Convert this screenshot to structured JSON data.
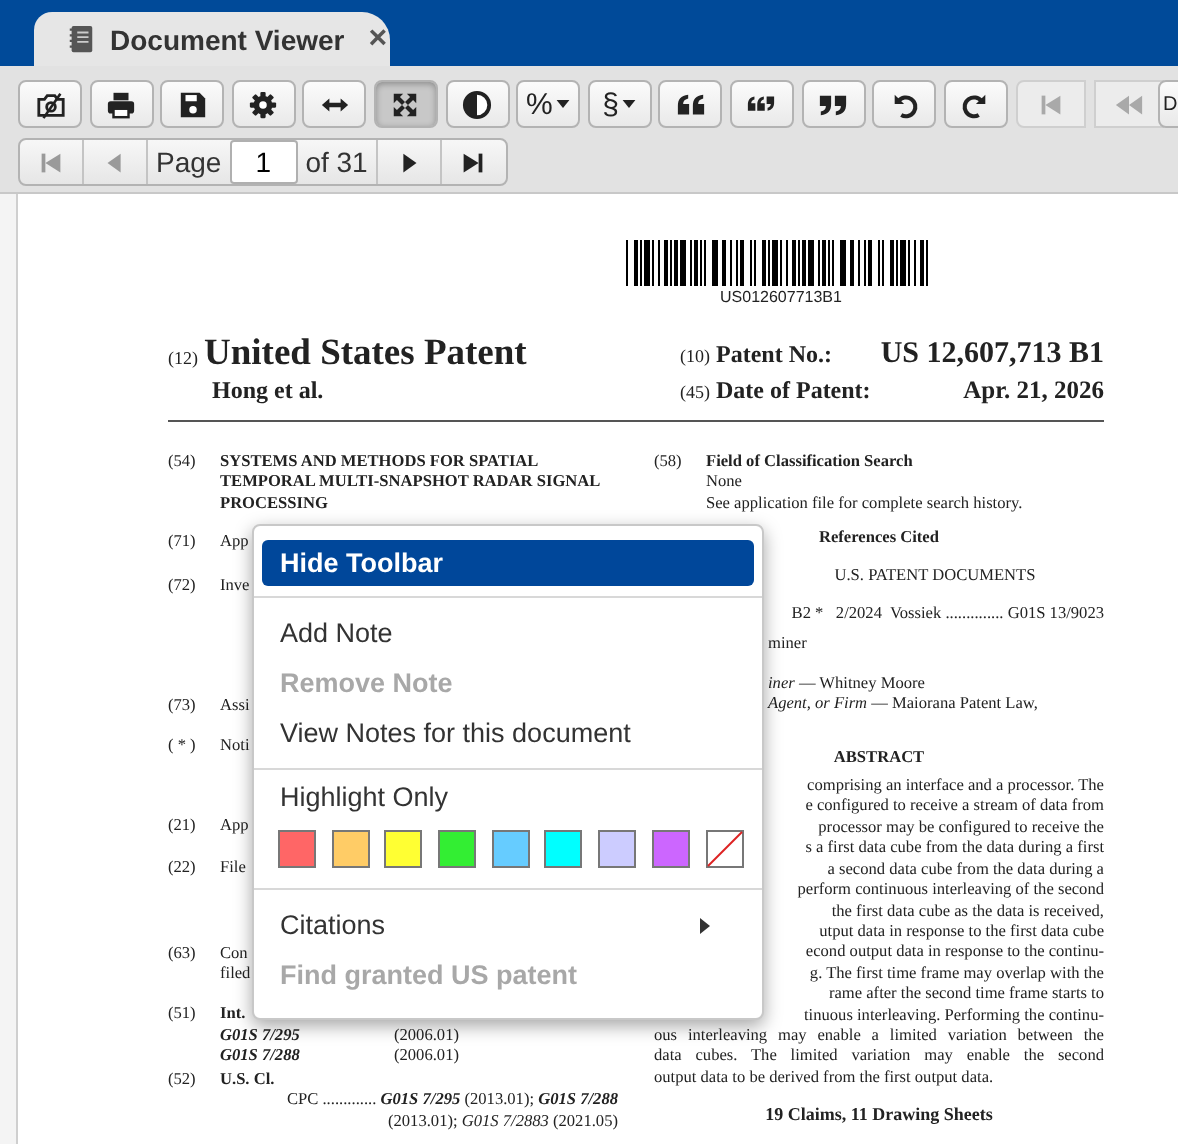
{
  "tab": {
    "title": "Document Viewer",
    "close": "×"
  },
  "toolbar": [
    {
      "pressed": false,
      "disabled": false,
      "dropdown": false
    },
    {
      "pressed": false,
      "disabled": false,
      "dropdown": false
    },
    {
      "pressed": false,
      "disabled": false,
      "dropdown": false
    },
    {
      "pressed": false,
      "disabled": false,
      "dropdown": false
    },
    {
      "pressed": false,
      "disabled": false,
      "dropdown": false
    },
    {
      "pressed": true,
      "disabled": false,
      "dropdown": false
    },
    {
      "pressed": false,
      "disabled": false,
      "dropdown": false
    },
    {
      "label": "%",
      "pressed": false,
      "disabled": false,
      "dropdown": true
    },
    {
      "label": "§",
      "pressed": false,
      "disabled": false,
      "dropdown": true
    },
    {
      "pressed": false,
      "disabled": false,
      "dropdown": false
    },
    {
      "pressed": false,
      "disabled": false,
      "dropdown": false
    },
    {
      "pressed": false,
      "disabled": false,
      "dropdown": false
    },
    {
      "pressed": false,
      "disabled": false,
      "dropdown": false
    },
    {
      "pressed": false,
      "disabled": false,
      "dropdown": false
    },
    {
      "pressed": false,
      "disabled": true,
      "dropdown": false
    },
    {
      "pressed": false,
      "disabled": true,
      "dropdown": false
    },
    {
      "label": "D",
      "pressed": false,
      "disabled": false
    }
  ],
  "pager": {
    "first": {
      "disabled": true
    },
    "previous": {
      "disabled": true
    },
    "label": "Page",
    "page": "1",
    "of": "of 31",
    "next": {
      "disabled": false
    },
    "last": {
      "disabled": false
    }
  },
  "document": {
    "barcode_text": "US012607713B1",
    "header": {
      "kind_num": "(12)",
      "kind": "United States Patent",
      "inventor": "Hong et al.",
      "patent_no_num": "(10)",
      "patent_no_label": "Patent No.:",
      "patent_no": "US 12,607,713 B1",
      "date_num": "(45)",
      "date_label": "Date of Patent:",
      "date": "Apr. 21, 2026"
    },
    "left": [
      {
        "num": "(54)",
        "kind": "title",
        "text": "SYSTEMS AND METHODS FOR SPATIAL TEMPORAL MULTI-SNAPSHOT RADAR SIGNAL PROCESSING"
      },
      {
        "num": "(71)",
        "kind": "field",
        "lines": [
          "App"
        ]
      },
      {
        "num": "(72)",
        "kind": "field",
        "lines": [
          "Inve"
        ]
      },
      {
        "num": "(73)",
        "kind": "field",
        "lines": [
          "Assi"
        ]
      },
      {
        "num": "( * )",
        "kind": "field",
        "lines": [
          "Noti"
        ]
      },
      {
        "num": "(21)",
        "kind": "field",
        "lines": [
          "App"
        ]
      },
      {
        "num": "(22)",
        "kind": "field",
        "lines": [
          "File"
        ]
      },
      {
        "num": "(63)",
        "kind": "field",
        "lines": [
          "Con",
          "filed"
        ]
      },
      {
        "num": "(51)",
        "kind": "class",
        "heading": "Int.",
        "codes": [
          {
            "code": "G01S 7/295",
            "version": "(2006.01)"
          },
          {
            "code": "G01S 7/288",
            "version": "(2006.01)"
          }
        ]
      },
      {
        "num": "(52)",
        "kind": "cpc",
        "heading": "U.S. Cl.",
        "lines": [
          "CPC ............. **G01S 7/295** (2013.01); **G01S 7/288**",
          "(2013.01); *G01S 7/2883* (2021.05)"
        ]
      }
    ],
    "search": {
      "num": "(58)",
      "heading": "Field of Classification Search",
      "lines": [
        "None",
        "See application file for complete search history."
      ]
    },
    "references": {
      "title": "References Cited",
      "subtitle": "U.S. PATENT DOCUMENTS",
      "entries": [
        "B2 *   2/2024  Vossiek .............. G01S 13/9023"
      ]
    },
    "examiners": [
      "miner",
      "*iner* — Whitney Moore",
      "*Agent, or Firm* — Maiorana Patent Law,"
    ],
    "abstract": {
      "title": "ABSTRACT",
      "partial_lines": [
        "comprising an interface and a processor. The",
        "e configured to receive a stream of data from",
        "processor may be configured to receive the",
        "s a first data cube from the data during a first",
        "a second data cube from the data during a",
        "perform continuous interleaving of the second",
        "the first data cube as the data is received,",
        "utput data in response to the first data cube",
        "econd output data in response to the continu-",
        "g. The first time frame may overlap with the",
        "rame after the second time frame starts to",
        "tinuous interleaving. Performing the continu-"
      ],
      "lines": [
        "ous interleaving may enable a limited variation between the",
        "data cubes. The limited variation may enable the second",
        "output data to be derived from the first output data."
      ]
    },
    "claims": "19 Claims, 11 Drawing Sheets"
  },
  "context_menu": {
    "items": [
      {
        "kind": "action",
        "label": "Hide Toolbar",
        "selected": true,
        "disabled": false
      },
      {
        "kind": "separator"
      },
      {
        "kind": "action",
        "label": "Add Note",
        "selected": false,
        "disabled": false
      },
      {
        "kind": "action",
        "label": "Remove Note",
        "selected": false,
        "disabled": true
      },
      {
        "kind": "action",
        "label": "View Notes for this document",
        "selected": false,
        "disabled": false
      },
      {
        "kind": "separator"
      },
      {
        "kind": "heading",
        "label": "Highlight Only"
      },
      {
        "kind": "swatches",
        "swatches": [
          {
            "kind": "color",
            "color": "#ff6666"
          },
          {
            "kind": "color",
            "color": "#ffcc66"
          },
          {
            "kind": "color",
            "color": "#ffff33"
          },
          {
            "kind": "color",
            "color": "#33ee33"
          },
          {
            "kind": "color",
            "color": "#66ccff"
          },
          {
            "kind": "color",
            "color": "#00ffff"
          },
          {
            "kind": "color",
            "color": "#ccccff"
          },
          {
            "kind": "color",
            "color": "#cc66ff"
          },
          {
            "kind": "none"
          }
        ]
      },
      {
        "kind": "separator"
      },
      {
        "kind": "submenu",
        "label": "Citations",
        "selected": false,
        "disabled": false
      },
      {
        "kind": "action",
        "label": "Find granted US patent",
        "selected": false,
        "disabled": true
      }
    ]
  }
}
